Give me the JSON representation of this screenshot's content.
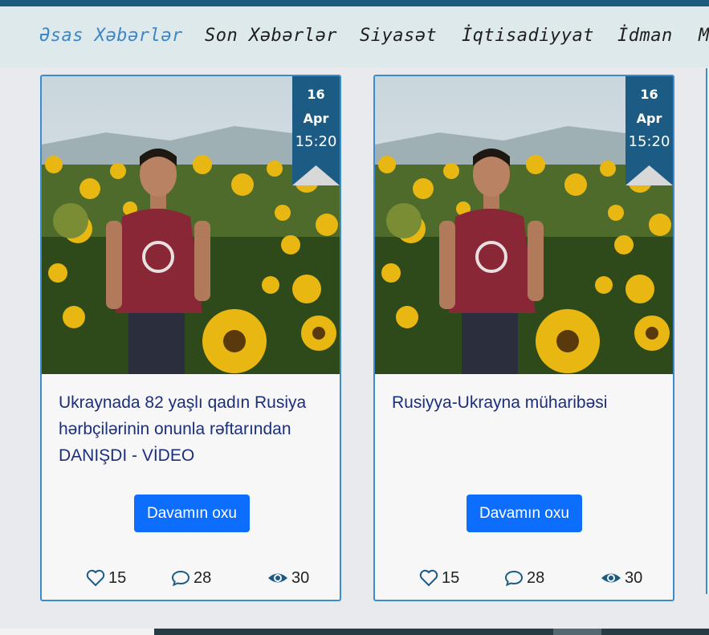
{
  "nav": {
    "items": [
      {
        "label": "Əsas Xəbərlər",
        "active": true
      },
      {
        "label": "Son Xəbərlər",
        "active": false
      },
      {
        "label": "Siyasət",
        "active": false
      },
      {
        "label": "İqtisadiyyat",
        "active": false
      },
      {
        "label": "İdman",
        "active": false
      },
      {
        "label": "M",
        "active": false
      }
    ]
  },
  "colors": {
    "accent": "#3e86c4",
    "badge": "#1b5b84",
    "button": "#0d6efd",
    "title": "#1c2f7a"
  },
  "cards": [
    {
      "date": {
        "day": "16",
        "month": "Apr",
        "time": "15:20"
      },
      "title": "Ukraynada 82 yaşlı qadın Rusiya hərbçilərinin onunla rəftarından DANIŞDI - VİDEO",
      "button": "Davamın oxu",
      "likes": "15",
      "comments": "28",
      "views": "30"
    },
    {
      "date": {
        "day": "16",
        "month": "Apr",
        "time": "15:20"
      },
      "title": "Rusiyya-Ukrayna müharibəsi",
      "button": "Davamın oxu",
      "likes": "15",
      "comments": "28",
      "views": "30"
    }
  ],
  "icons": {
    "like": "heart-icon",
    "comment": "comment-icon",
    "views": "eye-icon"
  }
}
